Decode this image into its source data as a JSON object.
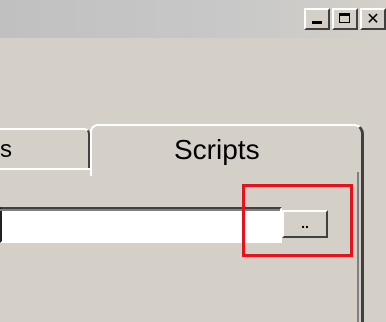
{
  "window": {
    "caption_buttons": {
      "minimize_icon": "minimize-icon",
      "maximize_icon": "maximize-icon",
      "close_icon": "close-icon",
      "close_glyph": "✕"
    }
  },
  "tabs": [
    {
      "label": "s",
      "selected": false
    },
    {
      "label": "Scripts",
      "selected": true
    }
  ],
  "scripts_panel": {
    "path_field": {
      "value": "",
      "placeholder": ""
    },
    "browse_button": {
      "label": ".."
    }
  },
  "annotation": {
    "highlight_color": "#e8101a"
  },
  "colors": {
    "face": "#d4d0c8",
    "highlight": "#ffffff",
    "shadow": "#404040"
  }
}
